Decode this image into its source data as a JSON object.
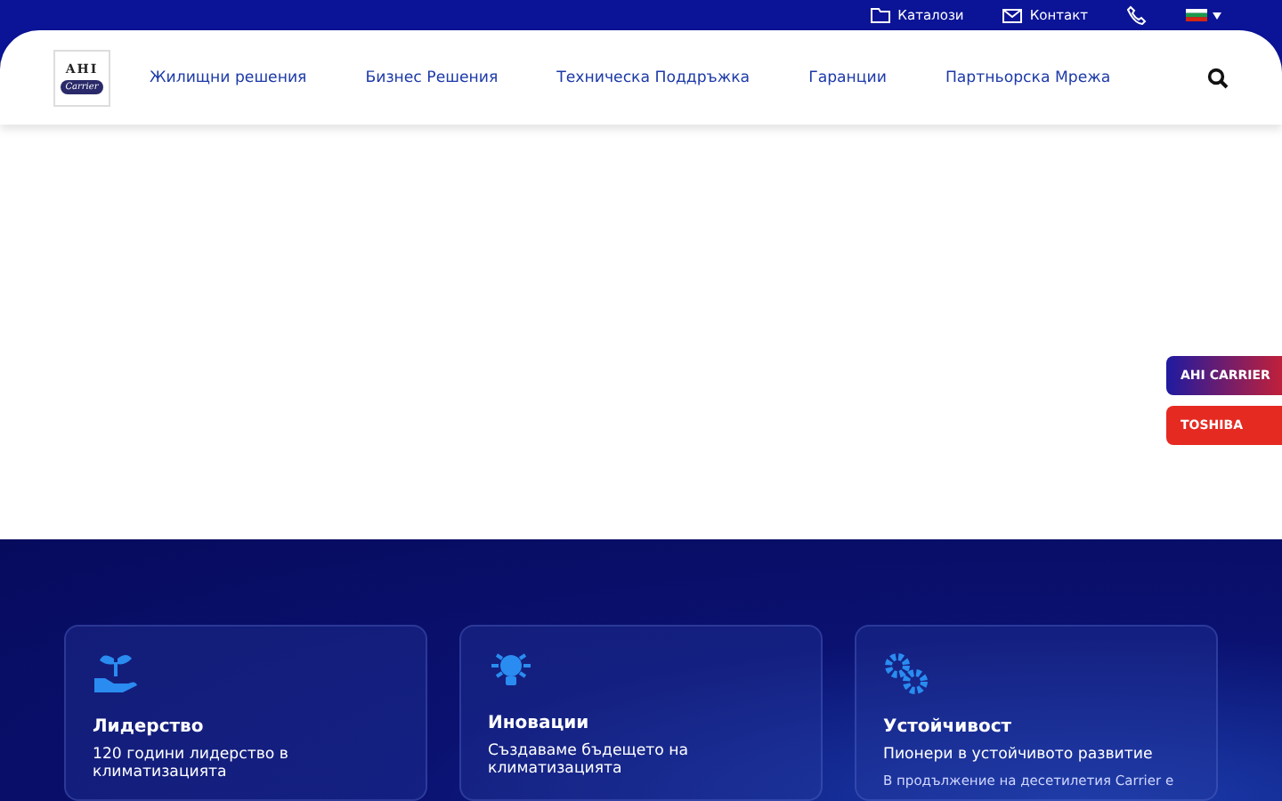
{
  "top_bar": {
    "links": [
      {
        "kind": "catalog",
        "label": "Каталози"
      },
      {
        "kind": "contact",
        "label": "Контакт"
      },
      {
        "kind": "phone"
      },
      {
        "kind": "flag"
      }
    ]
  },
  "header": {
    "logo": {
      "top": "AHI",
      "bottom": "Carrier"
    },
    "nav": [
      "Жилищни решения",
      "Бизнес Решения",
      "Техническа Поддръжка",
      "Гаранции",
      "Партньорска Мрежа"
    ]
  },
  "side_tabs": [
    {
      "label": "AHI CARRIER",
      "kind": "gradient"
    },
    {
      "label": "TOSHIBA",
      "kind": "solid"
    }
  ],
  "features": [
    {
      "kind": "plant",
      "title": "Лидерство",
      "subtitle": "120 години лидерство в климатизацията"
    },
    {
      "kind": "bulb",
      "title": "Иновации",
      "subtitle": "Създаваме бъдещето на климатизацията"
    },
    {
      "kind": "gears",
      "title": "Устойчивост",
      "subtitle": "Пионери в устойчивото развитие",
      "text": "В продължение на десетилетия Carrier е"
    }
  ]
}
